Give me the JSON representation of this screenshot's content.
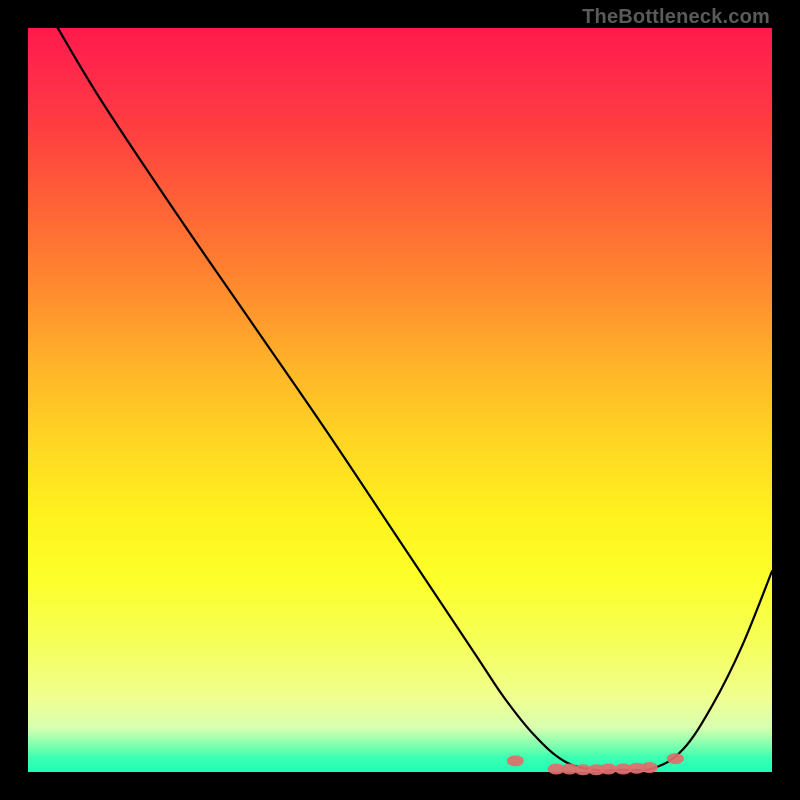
{
  "watermark": "TheBottleneck.com",
  "chart_data": {
    "type": "line",
    "title": "",
    "xlabel": "",
    "ylabel": "",
    "xlim": [
      0,
      100
    ],
    "ylim": [
      0,
      100
    ],
    "grid": false,
    "series": [
      {
        "name": "curve",
        "x": [
          4,
          10,
          20,
          30,
          40,
          50,
          60,
          64,
          68,
          72,
          76,
          80,
          84,
          88,
          92,
          96,
          100
        ],
        "values": [
          100,
          90,
          75,
          60.5,
          46,
          31,
          16,
          10,
          5,
          1.5,
          0.3,
          0.3,
          0.5,
          3,
          9,
          17,
          27
        ]
      }
    ],
    "markers": [
      {
        "x": 65.5,
        "y": 1.5
      },
      {
        "x": 71.0,
        "y": 0.4
      },
      {
        "x": 72.8,
        "y": 0.4
      },
      {
        "x": 74.6,
        "y": 0.3
      },
      {
        "x": 76.4,
        "y": 0.3
      },
      {
        "x": 78.0,
        "y": 0.4
      },
      {
        "x": 80.0,
        "y": 0.4
      },
      {
        "x": 81.8,
        "y": 0.5
      },
      {
        "x": 83.5,
        "y": 0.6
      },
      {
        "x": 87.0,
        "y": 1.8
      }
    ],
    "colors": {
      "line": "#000000",
      "marker": "#e26d6d"
    }
  }
}
